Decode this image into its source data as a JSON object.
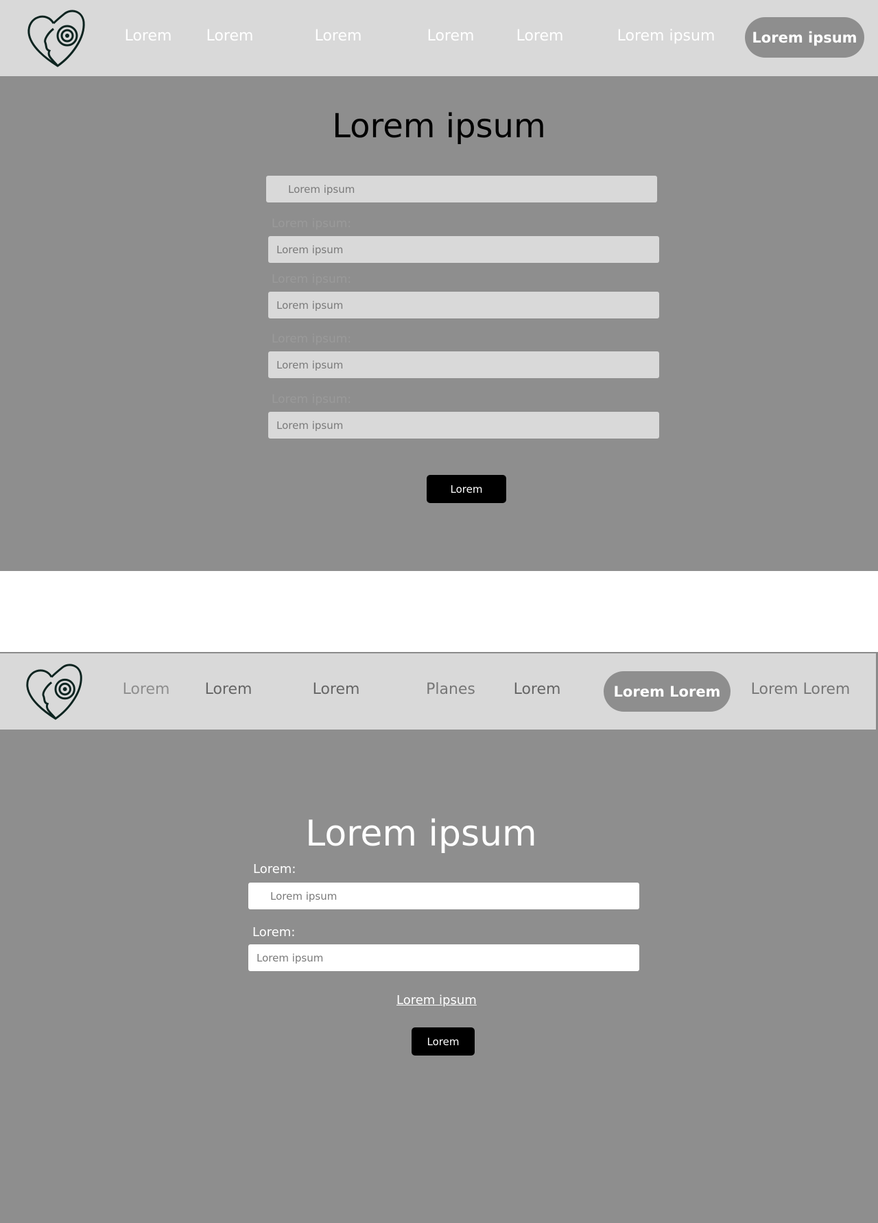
{
  "screen1": {
    "nav": {
      "items": [
        "Lorem",
        "Lorem",
        "Lorem",
        "Lorem",
        "Lorem",
        "Lorem ipsum"
      ],
      "active": "Lorem ipsum"
    },
    "title": "Lorem ipsum",
    "first_input_placeholder": "Lorem ipsum",
    "fields": [
      {
        "label": "Lorem ipsum:",
        "placeholder": "Lorem ipsum"
      },
      {
        "label": "Lorem ipsum:",
        "placeholder": "Lorem ipsum"
      },
      {
        "label": "Lorem ipsum:",
        "placeholder": "Lorem ipsum"
      },
      {
        "label": "Lorem ipsum:",
        "placeholder": "Lorem ipsum"
      }
    ],
    "submit": "Lorem"
  },
  "screen2": {
    "nav": {
      "items": [
        "Lorem",
        "Lorem",
        "Lorem",
        "Planes",
        "Lorem",
        "Lorem Lorem"
      ],
      "active": "Lorem Lorem"
    },
    "title": "Lorem ipsum",
    "fields": [
      {
        "label": "Lorem:",
        "placeholder": "Lorem ipsum"
      },
      {
        "label": "Lorem:",
        "placeholder": "Lorem ipsum"
      }
    ],
    "link": "Lorem ipsum",
    "submit": "Lorem"
  },
  "colors": {
    "nav_bg": "#d9d9d9",
    "main_bg": "#8e8e8e",
    "button": "#000000"
  }
}
